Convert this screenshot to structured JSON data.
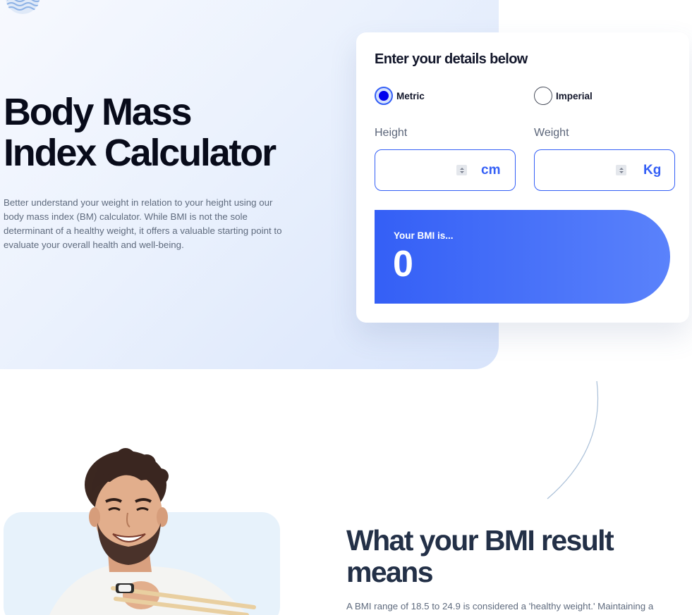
{
  "hero": {
    "title_line1": "Body Mass",
    "title_line2": "Index Calculator",
    "description": "Better understand your weight in relation to your height using our body mass index (BM) calculator. While BMI is not the sole determinant of a healthy weight, it offers a valuable starting point to evaluate your overall health and well-being."
  },
  "calculator": {
    "title": "Enter your details below",
    "units": [
      {
        "label": "Metric",
        "selected": true
      },
      {
        "label": "Imperial",
        "selected": false
      }
    ],
    "height": {
      "label": "Height",
      "unit": "cm",
      "value": ""
    },
    "weight": {
      "label": "Weight",
      "unit": "Kg",
      "value": ""
    },
    "result": {
      "label": "Your BMI is...",
      "value": "0"
    }
  },
  "meaning": {
    "title": "What your BMI result means",
    "text": "A BMI range of 18.5 to 24.9 is considered a 'healthy weight.' Maintaining a"
  },
  "icons": {
    "logo": "wave-logo-icon",
    "spinner": "number-spinner-icon"
  },
  "colors": {
    "accent": "#345ff6",
    "accent_light": "#5a82fb",
    "heading": "#080b1a",
    "body_text": "#5f6b7e",
    "hero_bg": "#e4edfc",
    "photo_bg": "#e7f2fb"
  }
}
